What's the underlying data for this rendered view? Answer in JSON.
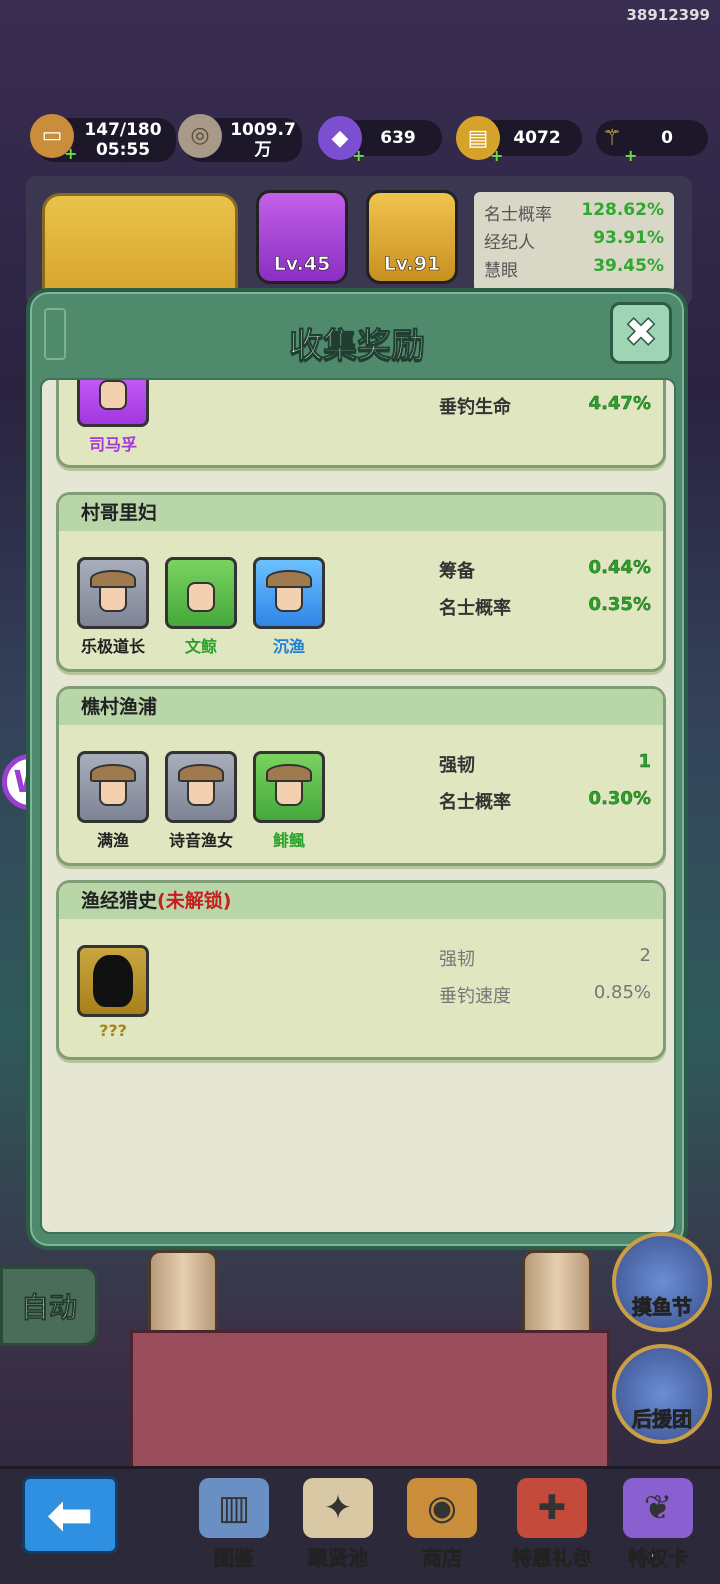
{
  "user_id": "38912399",
  "resources": [
    {
      "icon": "stamina-icon",
      "value": "147/180",
      "sub": "05:55",
      "plus": true
    },
    {
      "icon": "coin-icon",
      "value": "1009.7",
      "sub": "万",
      "plus": false
    },
    {
      "icon": "gem-icon",
      "value": "639",
      "sub": "",
      "plus": true
    },
    {
      "icon": "scroll-icon",
      "value": "4072",
      "sub": "",
      "plus": true
    },
    {
      "icon": "trident-icon",
      "value": "0",
      "sub": "",
      "plus": true
    }
  ],
  "top_panel": {
    "levels": [
      {
        "label": "Lv.45",
        "color": "#a53ad9"
      },
      {
        "label": "Lv.91",
        "color": "#d6a32a"
      }
    ],
    "stats": [
      {
        "name": "名士概率",
        "value": "128.62%"
      },
      {
        "name": "经纪人",
        "value": "93.91%"
      },
      {
        "name": "慧眼",
        "value": "39.45%"
      }
    ]
  },
  "modal": {
    "title": "收集奖励",
    "close_symbol": "✖"
  },
  "collections": [
    {
      "title": "",
      "heroes": [
        {
          "name": "司马孚",
          "rarity": "purple"
        }
      ],
      "bonuses": [
        {
          "name": "垂钓生命",
          "value": "4.47%"
        }
      ],
      "locked": false
    },
    {
      "title": "村哥里妇",
      "heroes": [
        {
          "name": "乐极道长",
          "rarity": "gray"
        },
        {
          "name": "文鲸",
          "rarity": "green"
        },
        {
          "name": "沉渔",
          "rarity": "blue"
        }
      ],
      "bonuses": [
        {
          "name": "筹备",
          "value": "0.44%"
        },
        {
          "name": "名士概率",
          "value": "0.35%"
        }
      ],
      "locked": false
    },
    {
      "title": "樵村渔浦",
      "heroes": [
        {
          "name": "满渔",
          "rarity": "gray"
        },
        {
          "name": "诗音渔女",
          "rarity": "gray"
        },
        {
          "name": "鲱鲺",
          "rarity": "green"
        }
      ],
      "bonuses": [
        {
          "name": "强韧",
          "value": "1"
        },
        {
          "name": "名士概率",
          "value": "0.30%"
        }
      ],
      "locked": false
    },
    {
      "title": "渔经猎史",
      "locked_label": "(未解锁)",
      "heroes": [
        {
          "name": "???",
          "rarity": "gold"
        }
      ],
      "bonuses": [
        {
          "name": "强韧",
          "value": "2"
        },
        {
          "name": "垂钓速度",
          "value": "0.85%"
        }
      ],
      "locked": true
    }
  ],
  "side_buttons": {
    "auto": "自动",
    "fish_festival": "摸鱼节",
    "support_group": "后援团"
  },
  "nav": [
    {
      "label": "图鉴",
      "icon": "book-icon"
    },
    {
      "label": "聚贤池",
      "icon": "map-icon"
    },
    {
      "label": "商店",
      "icon": "shop-icon"
    },
    {
      "label": "特惠礼包",
      "icon": "gift-icon"
    },
    {
      "label": "特权卡",
      "icon": "card-icon"
    }
  ],
  "floating_badge": "W"
}
